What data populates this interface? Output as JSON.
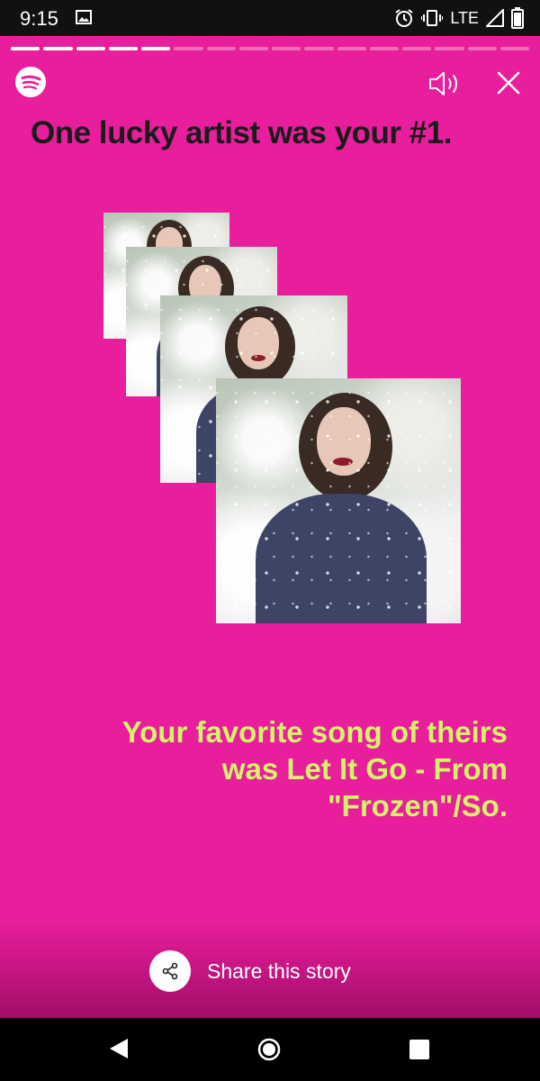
{
  "status_bar": {
    "time": "9:15",
    "network": "LTE",
    "icons": [
      "image-notification-icon",
      "alarm-icon",
      "vibrate-icon",
      "signal-icon",
      "battery-icon"
    ]
  },
  "story": {
    "background_color": "#e91e9c",
    "progress": {
      "total_segments": 16,
      "completed_segments": 5
    },
    "headline": "One lucky artist was your #1.",
    "favorite_song_text": "Your favorite song of theirs was Let It Go - From \"Frozen\"/So.",
    "accent_color": "#d7f26a",
    "share_label": "Share this story",
    "icons": [
      "spotify-logo-icon",
      "speaker-icon",
      "close-icon",
      "share-icon"
    ]
  },
  "nav_bar": {
    "icons": [
      "back-icon",
      "home-icon",
      "recents-icon"
    ]
  }
}
